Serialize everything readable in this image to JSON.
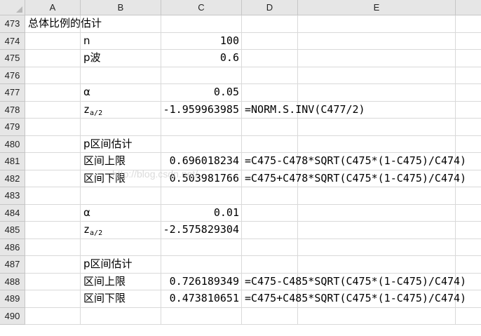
{
  "columns": [
    "A",
    "B",
    "C",
    "D",
    "E"
  ],
  "rows": [
    {
      "num": "473",
      "a": "总体比例的估计",
      "b": "",
      "c": "",
      "d": ""
    },
    {
      "num": "474",
      "a": "",
      "b": "n",
      "c": "100",
      "d": ""
    },
    {
      "num": "475",
      "a": "",
      "b": "p波",
      "c": "0.6",
      "d": ""
    },
    {
      "num": "476",
      "a": "",
      "b": "",
      "c": "",
      "d": ""
    },
    {
      "num": "477",
      "a": "",
      "b": "α",
      "c": "0.05",
      "d": ""
    },
    {
      "num": "478",
      "a": "",
      "b_main": "z",
      "b_sub": "a/2",
      "c": "-1.959963985",
      "d": "=NORM.S.INV(C477/2)"
    },
    {
      "num": "479",
      "a": "",
      "b": "",
      "c": "",
      "d": ""
    },
    {
      "num": "480",
      "a": "",
      "b": "p区间估计",
      "c": "",
      "d": ""
    },
    {
      "num": "481",
      "a": "",
      "b": "区间上限",
      "c": "0.696018234",
      "d": "=C475-C478*SQRT(C475*(1-C475)/C474)"
    },
    {
      "num": "482",
      "a": "",
      "b": "区间下限",
      "c": "0.503981766",
      "d": "=C475+C478*SQRT(C475*(1-C475)/C474)"
    },
    {
      "num": "483",
      "a": "",
      "b": "",
      "c": "",
      "d": ""
    },
    {
      "num": "484",
      "a": "",
      "b": "α",
      "c": "0.01",
      "d": ""
    },
    {
      "num": "485",
      "a": "",
      "b_main": "z",
      "b_sub": "a/2",
      "c": "-2.575829304",
      "d": ""
    },
    {
      "num": "486",
      "a": "",
      "b": "",
      "c": "",
      "d": ""
    },
    {
      "num": "487",
      "a": "",
      "b": "p区间估计",
      "c": "",
      "d": ""
    },
    {
      "num": "488",
      "a": "",
      "b": "区间上限",
      "c": "0.726189349",
      "d": "=C475-C485*SQRT(C475*(1-C475)/C474)"
    },
    {
      "num": "489",
      "a": "",
      "b": "区间下限",
      "c": "0.473810651",
      "d": "=C475+C485*SQRT(C475*(1-C475)/C474)"
    },
    {
      "num": "490",
      "a": "",
      "b": "",
      "c": "",
      "d": ""
    }
  ],
  "watermark": "http://blog.csdn.net/"
}
